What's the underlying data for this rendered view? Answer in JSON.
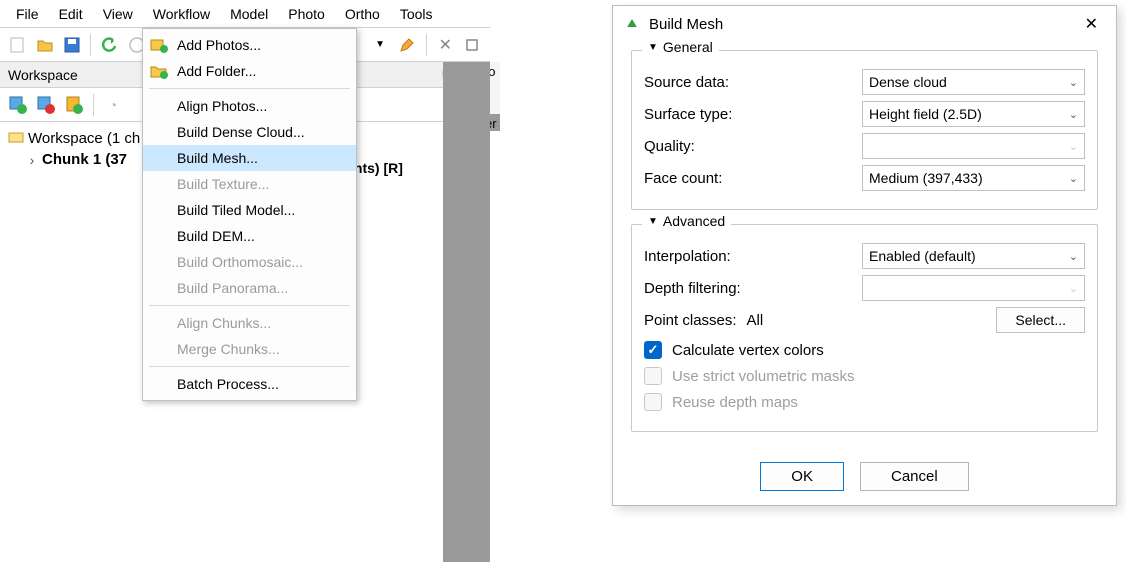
{
  "menubar": {
    "file": "File",
    "edit": "Edit",
    "view": "View",
    "workflow": "Workflow",
    "model": "Model",
    "photo": "Photo",
    "ortho": "Ortho",
    "tools": "Tools"
  },
  "workspace": {
    "panel_title": "Workspace",
    "root": "Workspace (1 ch",
    "chunk": "Chunk 1 (37",
    "behind_text": "ints) [R]",
    "right_tab_1": "Mo",
    "right_tab_2": "Per"
  },
  "dropdown": {
    "add_photos": "Add Photos...",
    "add_folder": "Add Folder...",
    "align_photos": "Align Photos...",
    "build_dense": "Build Dense Cloud...",
    "build_mesh": "Build Mesh...",
    "build_texture": "Build Texture...",
    "build_tiled": "Build Tiled Model...",
    "build_dem": "Build DEM...",
    "build_ortho": "Build Orthomosaic...",
    "build_pano": "Build Panorama...",
    "align_chunks": "Align Chunks...",
    "merge_chunks": "Merge Chunks...",
    "batch": "Batch Process..."
  },
  "dialog": {
    "title": "Build Mesh",
    "general_legend": "General",
    "advanced_legend": "Advanced",
    "labels": {
      "source": "Source data:",
      "surface": "Surface type:",
      "quality": "Quality:",
      "facecount": "Face count:",
      "interp": "Interpolation:",
      "depthfilt": "Depth filtering:",
      "pointclasses": "Point classes:",
      "pointclasses_val": "All",
      "select": "Select...",
      "calcvertex": "Calculate vertex colors",
      "strictmask": "Use strict volumetric masks",
      "reusedepth": "Reuse depth maps"
    },
    "values": {
      "source": "Dense cloud",
      "surface": "Height field (2.5D)",
      "quality": "",
      "facecount": "Medium (397,433)",
      "interp": "Enabled (default)",
      "depthfilt": ""
    },
    "buttons": {
      "ok": "OK",
      "cancel": "Cancel"
    }
  }
}
